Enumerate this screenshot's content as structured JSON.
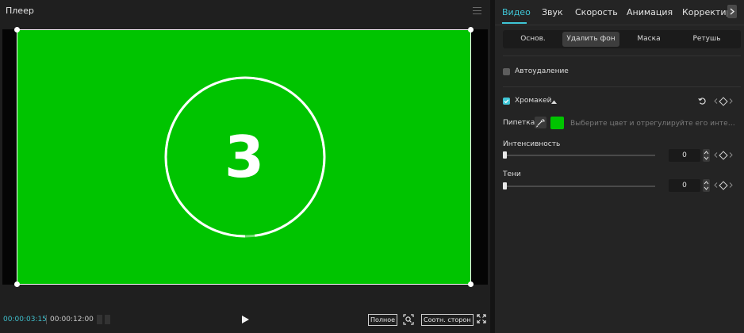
{
  "player": {
    "title": "Плеер",
    "countdown_number": "3",
    "countdown_progress": 0.98,
    "green_screen_color": "#00c400",
    "footer": {
      "current_time": "00:00:03:15",
      "total_time": "00:00:12:00",
      "full_label": "Полное",
      "ratio_label": "Соотн. сторон"
    }
  },
  "inspector": {
    "tabs": [
      {
        "label": "Видео",
        "active": true
      },
      {
        "label": "Звук",
        "active": false
      },
      {
        "label": "Скорость",
        "active": false
      },
      {
        "label": "Анимация",
        "active": false
      },
      {
        "label": "Корректир",
        "active": false
      }
    ],
    "subtabs": [
      {
        "label": "Основ.",
        "active": false
      },
      {
        "label": "Удалить фон",
        "active": true
      },
      {
        "label": "Маска",
        "active": false
      },
      {
        "label": "Ретушь",
        "active": false
      }
    ],
    "auto_remove": {
      "label": "Автоудаление",
      "checked": false
    },
    "chroma_key": {
      "label": "Хромакей",
      "checked": true
    },
    "eyedropper": {
      "label": "Пипетка",
      "swatch_color": "#00c400",
      "hint": "Выберите цвет и отрегулируйте его интенсивн..."
    },
    "intensity": {
      "label": "Интенсивность",
      "value": "0"
    },
    "shadows": {
      "label": "Тени",
      "value": "0"
    }
  },
  "colors": {
    "accent": "#3fc6d6",
    "timecode": "#3fbecb"
  }
}
